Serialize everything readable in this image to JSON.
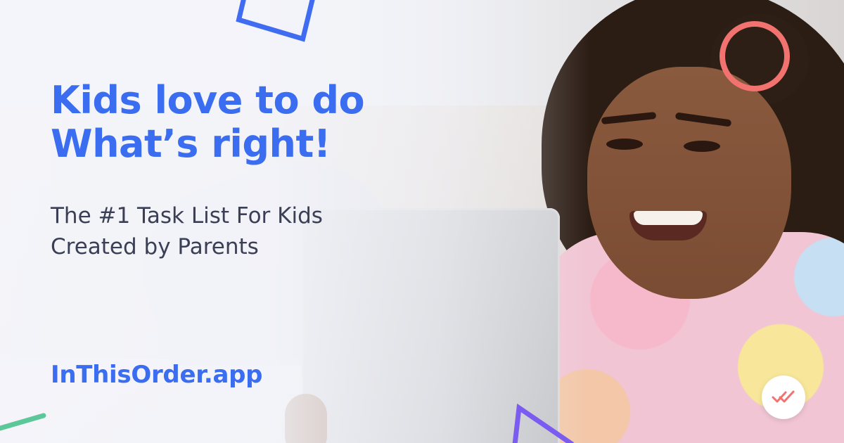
{
  "headline": {
    "line1": "Kids love to do",
    "line2": "What’s right!"
  },
  "subheadline": {
    "line1": "The #1 Task List For Kids",
    "line2": "Created by Parents"
  },
  "site_link": "InThisOrder.app",
  "icons": {
    "app_badge": "double-check-icon",
    "decor": [
      "blue-square-outline",
      "coral-circle-outline",
      "purple-triangle-outline",
      "green-line"
    ]
  },
  "colors": {
    "brand_blue": "#3b6df0",
    "body_text": "#3a3f55",
    "coral": "#f2726f",
    "purple": "#7a5cf0",
    "green": "#5cc89a",
    "square_blue": "#3f6cf0"
  }
}
